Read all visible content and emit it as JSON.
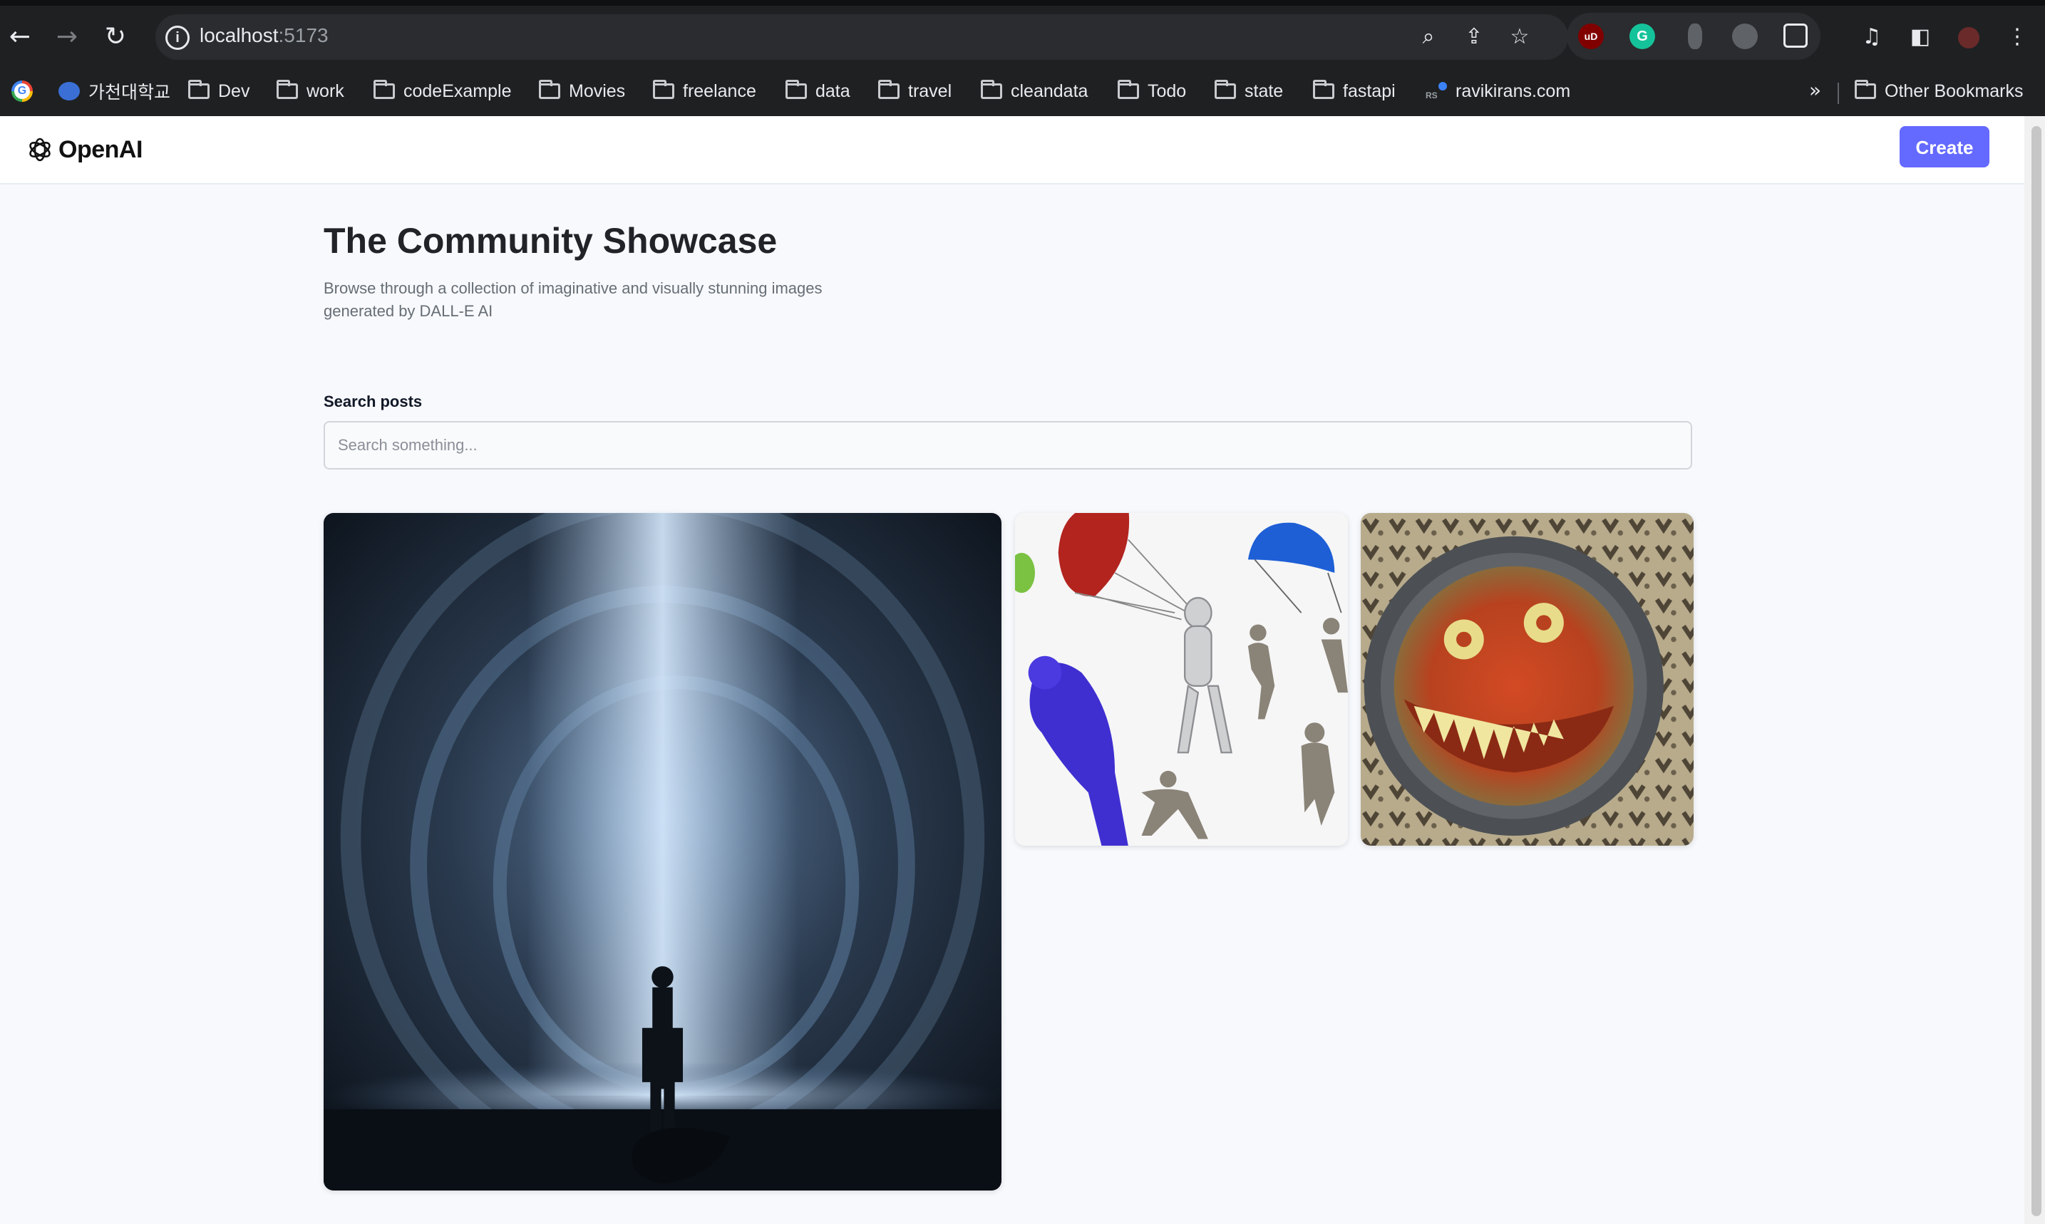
{
  "browser": {
    "url_host": "localhost",
    "url_port": ":5173",
    "bookmarks": [
      {
        "label": "",
        "icon": "google-icon"
      },
      {
        "label": "가천대학교",
        "icon": "university-icon"
      },
      {
        "label": "Dev",
        "icon": "folder-icon"
      },
      {
        "label": "work",
        "icon": "folder-icon"
      },
      {
        "label": "codeExample",
        "icon": "folder-icon"
      },
      {
        "label": "Movies",
        "icon": "folder-icon"
      },
      {
        "label": "freelance",
        "icon": "folder-icon"
      },
      {
        "label": "data",
        "icon": "folder-icon"
      },
      {
        "label": "travel",
        "icon": "folder-icon"
      },
      {
        "label": "cleandata",
        "icon": "folder-icon"
      },
      {
        "label": "Todo",
        "icon": "folder-icon"
      },
      {
        "label": "state",
        "icon": "folder-icon"
      },
      {
        "label": "fastapi",
        "icon": "folder-icon"
      },
      {
        "label": "ravikirans.com",
        "icon": "site-icon"
      }
    ],
    "more_bookmarks": "»",
    "other_bookmarks": "Other Bookmarks",
    "extension_ublock_text": "uD",
    "extension_grammarly_text": "G",
    "rs_icon_text": "RS"
  },
  "header": {
    "logo_text": "OpenAI",
    "create_label": "Create"
  },
  "main": {
    "title": "The Community Showcase",
    "subtitle": "Browse through a collection of imaginative and visually stunning images generated by DALL-E AI",
    "search_label": "Search posts",
    "search_placeholder": "Search something...",
    "search_value": ""
  },
  "colors": {
    "accent": "#6469ff",
    "page_bg": "#f8f9fd",
    "chrome_bg": "#1f2022"
  }
}
